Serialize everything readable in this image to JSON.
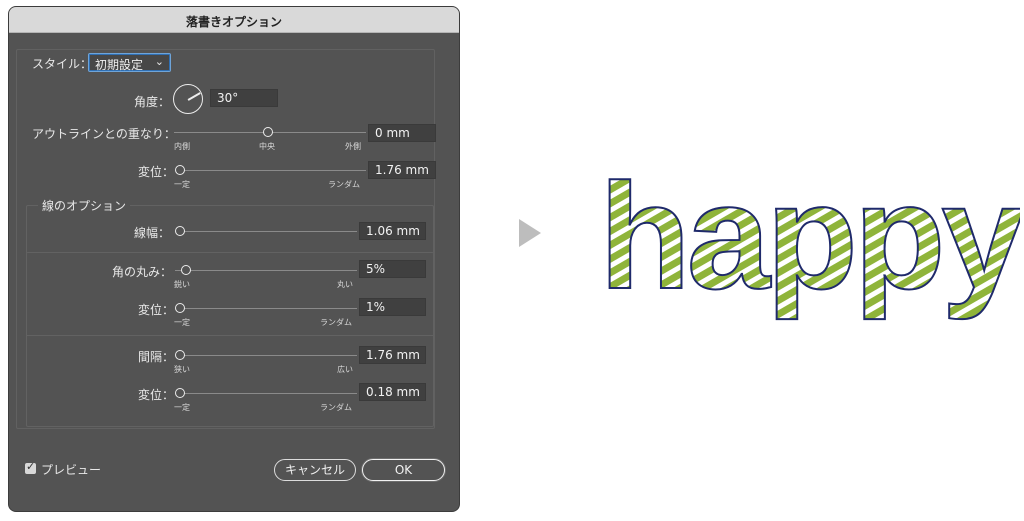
{
  "dialog": {
    "title": "落書きオプション",
    "style_label": "スタイル：",
    "style_value": "初期設定",
    "angle_label": "角度：",
    "angle_value": "30°",
    "outline_overlap": {
      "label": "アウトラインとの重なり：",
      "value": "0 mm",
      "min_label": "内側",
      "mid_label": "中央",
      "max_label": "外側",
      "position": 0.5
    },
    "overlap_variation": {
      "label": "変位：",
      "value": "1.76 mm",
      "min_label": "一定",
      "max_label": "ランダム",
      "position": 0.0
    },
    "line_options_header": "線のオプション",
    "stroke_width": {
      "label": "線幅：",
      "value": "1.06 mm",
      "position": 0.0
    },
    "curviness": {
      "label": "角の丸み：",
      "value": "5%",
      "min_label": "鋭い",
      "max_label": "丸い",
      "position": 0.05
    },
    "curviness_variation": {
      "label": "変位：",
      "value": "1%",
      "min_label": "一定",
      "max_label": "ランダム",
      "position": 0.01
    },
    "spacing": {
      "label": "間隔：",
      "value": "1.76 mm",
      "min_label": "狭い",
      "max_label": "広い",
      "position": 0.0
    },
    "spacing_variation": {
      "label": "変位：",
      "value": "0.18 mm",
      "min_label": "一定",
      "max_label": "ランダム",
      "position": 0.0
    },
    "preview_label": "プレビュー",
    "preview_checked": true,
    "cancel_label": "キャンセル",
    "ok_label": "OK"
  },
  "preview_image": {
    "text": "happy",
    "fill_color": "#8fb43a",
    "outline_color": "#1f2a6b"
  },
  "colors": {
    "panel_bg": "#535353",
    "field_bg": "#404040",
    "arrow": "#bdbdbd"
  }
}
